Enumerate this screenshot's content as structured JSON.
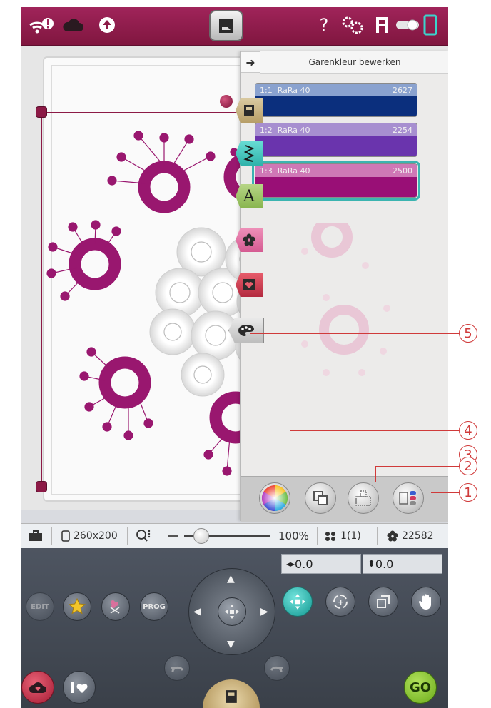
{
  "topbar": {
    "icons": [
      "wifi-alert-icon",
      "cloud-icon",
      "upload-icon",
      "home-icon",
      "help-icon",
      "settings-icon",
      "machine-icon",
      "toggle-icon",
      "tablet-icon"
    ],
    "help_label": "?"
  },
  "panel": {
    "title": "Garenkleur bewerken",
    "threads": [
      {
        "index": "1:1",
        "name": "RaRa 40",
        "code": "2627",
        "top_color": "#8aa2cf",
        "color": "#0b2f7d",
        "selected": false
      },
      {
        "index": "1:2",
        "name": "RaRa 40",
        "code": "2254",
        "top_color": "#a78fd0",
        "color": "#6a34ad",
        "selected": false
      },
      {
        "index": "1:3",
        "name": "RaRa 40",
        "code": "2500",
        "top_color": "#cf78b6",
        "color": "#990f76",
        "selected": true
      }
    ]
  },
  "side_tabs": [
    "hoop-tab-icon",
    "stitch-tab-icon",
    "font-tab-icon",
    "design-tab-icon",
    "heart-tab-icon",
    "palette-tab-icon"
  ],
  "font_tab_letter": "A",
  "statusbar": {
    "hoop": "260x200",
    "zoom": "100%",
    "zoom_level": 0.12,
    "designs": "1(1)",
    "stitches": "22582"
  },
  "controls": {
    "edit_label": "EDIT",
    "prog_label": "PROG",
    "go_label": "GO",
    "x_coord": "0.0",
    "y_coord": "0.0"
  },
  "callouts": [
    "1",
    "2",
    "3",
    "4",
    "5"
  ],
  "colors": {
    "brand": "#8c1a46",
    "accent_teal": "#3bb4b0",
    "thread": "#99176f"
  }
}
